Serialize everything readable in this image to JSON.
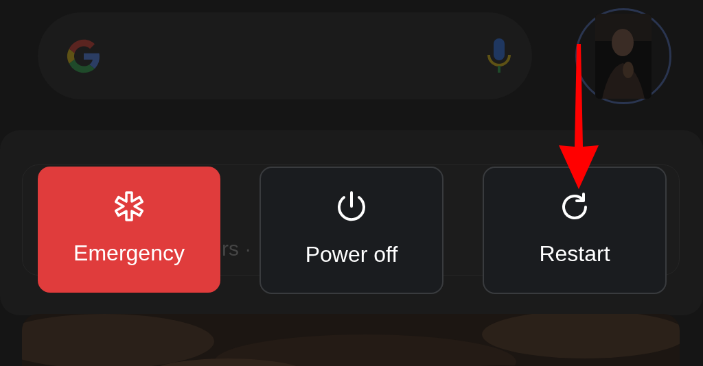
{
  "background_card": {
    "text": "rs ·"
  },
  "power_menu": [
    {
      "kind": "emergency",
      "label": "Emergency"
    },
    {
      "kind": "power",
      "label": "Power off"
    },
    {
      "kind": "restart",
      "label": "Restart"
    }
  ]
}
